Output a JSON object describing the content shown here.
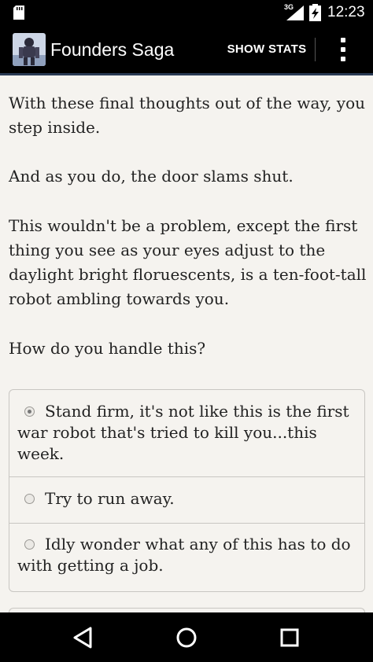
{
  "status_bar": {
    "network_type": "3G",
    "time": "12:23",
    "icons": [
      "sd-card-icon",
      "cell-signal-icon",
      "battery-charging-icon"
    ]
  },
  "action_bar": {
    "title": "Founders Saga",
    "show_stats_label": "SHOW STATS",
    "icons": [
      "app-icon",
      "overflow-menu-icon"
    ]
  },
  "story": {
    "paragraphs": [
      "With these final thoughts out of the way, you step inside.",
      "And as you do, the door slams shut.",
      "This wouldn't be a problem, except the first thing you see as your eyes adjust to the daylight bright floruescents, is a ten-foot-tall robot ambling towards you.",
      "How do you handle this?"
    ]
  },
  "choices": [
    {
      "label": "Stand firm, it's not like this is the first war robot that's tried to kill you...this week.",
      "selected": true
    },
    {
      "label": "Try to run away.",
      "selected": false
    },
    {
      "label": "Idly wonder what any of this has to do with getting a job.",
      "selected": false
    }
  ],
  "nav_bar": {
    "icons": [
      "back-icon",
      "home-icon",
      "recents-icon"
    ]
  },
  "colors": {
    "background": "#f5f3ef",
    "bars": "#000000",
    "text": "#222222",
    "border": "#c8c6c2"
  }
}
